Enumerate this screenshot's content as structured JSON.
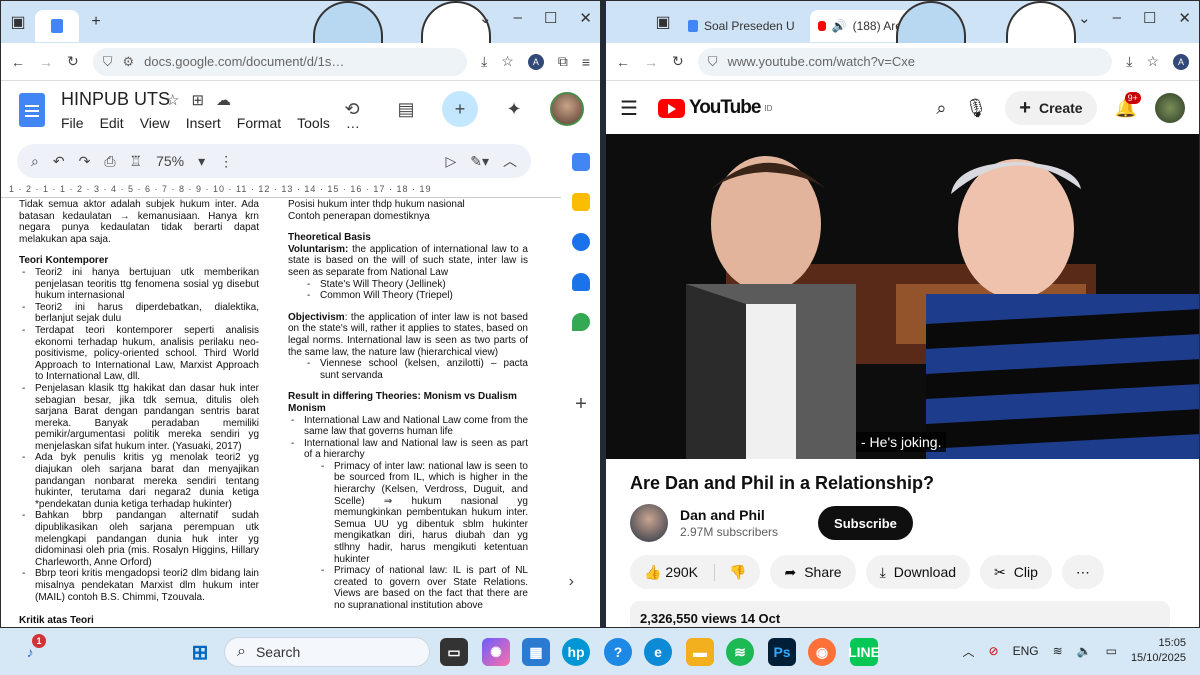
{
  "left_window": {
    "tabs": [
      {
        "label": ""
      }
    ],
    "url": "docs.google.com/document/d/1s…",
    "doc": {
      "title": "HINPUB UTS",
      "menu": [
        "File",
        "Edit",
        "View",
        "Insert",
        "Format",
        "Tools",
        "…"
      ],
      "zoom": "75%",
      "ruler": "1 · 2 · 1 · 1 · 2 · 3 · 4 · 5 · 6 · 7 · 8 · 9 · 10 · 11 · 12 · 13 · 14 · 15 · 16 · 17 · 18 · 19",
      "left_column": {
        "intro": "Tidak semua aktor adalah subjek hukum inter. Ada batasan kedaulatan → kemanusiaan. Hanya krn negara punya kedaulatan tidak berarti dapat melakukan apa saja.",
        "heading": "Teori Kontemporer",
        "items": [
          "Teori2 ini hanya bertujuan utk memberikan penjelasan teoritis ttg fenomena sosial yg disebut hukum internasional",
          "Teori2 ini harus diperdebatkan, dialektika, berlanjut sejak dulu",
          "Terdapat teori kontemporer seperti analisis ekonomi terhadap hukum, analisis perilaku neo-positivisme, policy-oriented school. Third World Approach to International Law, Marxist Approach to International Law, dll.",
          "Penjelasan klasik ttg hakikat dan dasar huk inter sebagian besar, jika tdk semua, ditulis oleh sarjana Barat dengan pandangan sentris barat mereka. Banyak peradaban memiliki pemikir/argumentasi politik mereka sendiri yg menjelaskan sifat hukum inter. (Yasuaki, 2017)",
          "Ada byk penulis kritis yg menolak teori2 yg diajukan oleh sarjana barat dan menyajikan pandangan nonbarat mereka sendiri tentang hukinter, terutama dari negara2 dunia ketiga *pendekatan dunia ketiga terhadap hukinter)",
          "Bahkan bbrp pandangan alternatif sudah dipublikasikan oleh sarjana perempuan utk melengkapi pandangan dunia huk inter yg didominasi oleh pria (mis. Rosalyn Higgins, Hillary Charleworth, Anne Orford)",
          "Bbrp teori kritis mengadopsi teori2 dlm bidang lain misalnya pendekatan Marxist dlm hukum inter (MAIL) contoh B.S. Chimmi, Tzouvala."
        ],
        "footer": "Kritik atas Teori"
      },
      "right_column": {
        "top1": "Posisi hukum inter thdp hukum nasional",
        "top2": "Contoh penerapan domestiknya",
        "heading1": "Theoretical Basis",
        "voluntarism_label": "Voluntarism:",
        "voluntarism": "the application of international law to a state is based on the will of such state, inter law is seen as separate from National Law",
        "vol_items": [
          "State's Will Theory (Jellinek)",
          "Common Will Theory (Triepel)"
        ],
        "objectivism_label": "Objectivism",
        "objectivism": ": the application of inter law is not based on the state's will, rather it applies to states, based on legal norms. International law is seen as two parts of the same law, the nature law (hierarchical view)",
        "obj_items": [
          "Viennese school (kelsen, anzilotti) – pacta sunt servanda"
        ],
        "heading2": "Result in differing Theories: Monism vs Dualism Monism",
        "mon_items": [
          "International Law and National Law come from the same law that governs human life",
          "International law and National law is seen as part of a hierarchy"
        ],
        "mon_sub": [
          "Primacy of inter law: national law is seen to be sourced from IL, which is higher in the hierarchy (Kelsen, Verdross, Duguit, and Scelle) ⇒ hukum nasional yg memungkinkan pembentukan hukum inter. Semua UU yg dibentuk sblm hukinter mengikatkan diri, harus diubah dan yg stlhny hadir, harus mengikuti ketentuan hukinter",
          "Primacy of national law: IL is part of NL created to govern over State Relations. Views are based on the fact that there are no supranational institution above"
        ]
      }
    }
  },
  "right_window": {
    "tabs": [
      {
        "label": "Soal Preseden U"
      },
      {
        "label": "(188) Are D"
      }
    ],
    "url": "www.youtube.com/watch?v=Cxe",
    "youtube": {
      "logo": "YouTube",
      "logo_region": "ID",
      "create_label": "Create",
      "notif_count": "9+",
      "caption": "- He's joking.",
      "video_title": "Are Dan and Phil in a Relationship?",
      "channel_name": "Dan and Phil",
      "subscribers": "2.97M subscribers",
      "subscribe_label": "Subscribe",
      "likes": "290K",
      "share_label": "Share",
      "download_label": "Download",
      "clip_label": "Clip",
      "views_text": "2,326,550 views  14 Oct"
    }
  },
  "taskbar": {
    "search_placeholder": "Search",
    "notif_badge": "1",
    "language": "ENG",
    "time": "15:05",
    "date": "15/10/2025"
  }
}
